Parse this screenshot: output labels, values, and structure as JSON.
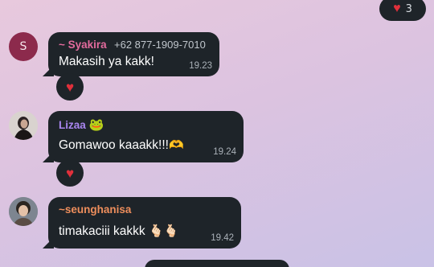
{
  "colors": {
    "bubble": "#1e2429",
    "heart": "#e0303b",
    "sender_syakira": "#e36b9d",
    "sender_lizaa": "#a986f0",
    "sender_seunghanisa": "#ee8e5c"
  },
  "top_reaction": {
    "icon": "heart-icon",
    "glyph": "♥",
    "count": "3"
  },
  "messages": [
    {
      "avatar_letter": "S",
      "sender": "~ Syakira",
      "phone": "+62 877-1909-7010",
      "text": "Makasih ya kakk!",
      "time": "19.23",
      "reaction": "♥"
    },
    {
      "sender": "Lizaa",
      "sender_emoji": "🐸",
      "text": "Gomawoo kaaakk!!!",
      "text_emoji": "🫶",
      "time": "19.24",
      "reaction": "♥"
    },
    {
      "sender": "~seunghanisa",
      "text": "timakaciii kakkk",
      "text_emoji": "🫰🏻🫰🏻",
      "time": "19.42"
    }
  ]
}
